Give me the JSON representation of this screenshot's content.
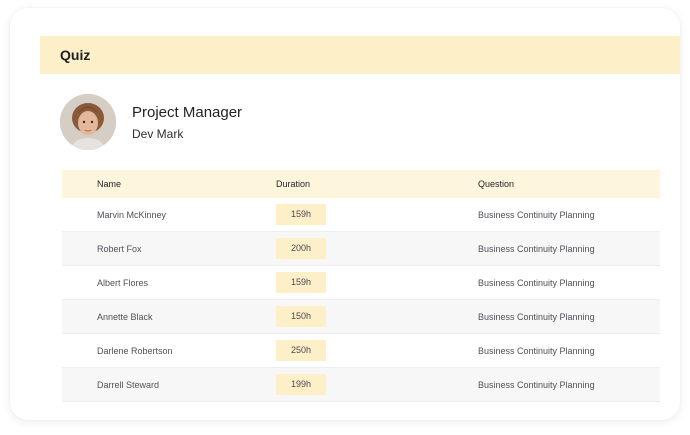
{
  "header": {
    "title": "Quiz"
  },
  "profile": {
    "role": "Project Manager",
    "name": "Dev Mark"
  },
  "table": {
    "columns": [
      "Name",
      "Duration",
      "Question"
    ],
    "rows": [
      {
        "name": "Marvin McKinney",
        "duration": "159h",
        "question": "Business Continuity Planning"
      },
      {
        "name": "Robert Fox",
        "duration": "200h",
        "question": "Business Continuity Planning"
      },
      {
        "name": "Albert Flores",
        "duration": "159h",
        "question": "Business Continuity Planning"
      },
      {
        "name": "Annette Black",
        "duration": "150h",
        "question": "Business Continuity Planning"
      },
      {
        "name": "Darlene Robertson",
        "duration": "250h",
        "question": "Business Continuity Planning"
      },
      {
        "name": "Darrell Steward",
        "duration": "199h",
        "question": "Business Continuity Planning"
      }
    ]
  },
  "colors": {
    "header_bg": "#fdf0c9",
    "table_header_bg": "#fdf5dc",
    "badge_bg": "#fdf0c9",
    "alt_row_bg": "#f7f7f8"
  }
}
